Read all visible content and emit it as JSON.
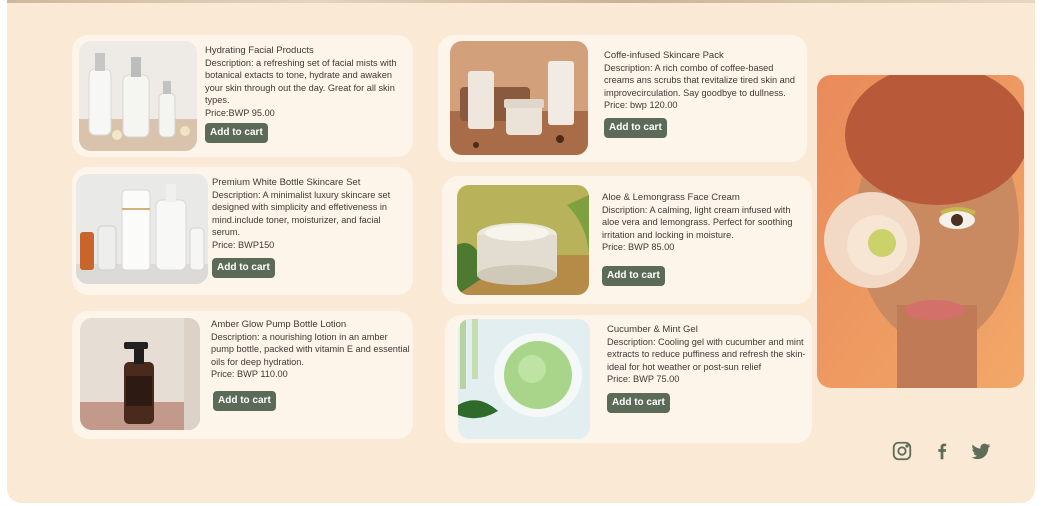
{
  "products": [
    {
      "title": "Hydrating Facial Products",
      "description": "Description: a refreshing set of facial mists with botanical extacts to tone, hydrate and awaken your skin through out the day. Great for all skin types.",
      "price": "Price:BWP 95.00",
      "button_label": "Add to cart",
      "image": "glass-serum-bottles"
    },
    {
      "title": "Coffe-infused Skincare Pack",
      "description": "Description: A rich combo of coffee-based creams ans scrubs that revitalize tired skin and improvecirculation. Say goodbye to dullness.",
      "price": "Price: bwp 120.00",
      "button_label": "Add to cart",
      "image": "coffee-skincare-tubes"
    },
    {
      "title": "Premium White Bottle Skincare Set",
      "description": "Description: A minimalist luxury skincare set designed with simplicity and effetiveness in mind.include toner, moisturizer, and facial serum.",
      "price": "Price: BWP150",
      "button_label": "Add to cart",
      "image": "white-bottles"
    },
    {
      "title": "Aloe & Lemongrass Face Cream",
      "description": "Discription: A calming, light cream infused with aloe vera and lemongrass. Perfect for soothing irritation and locking in moisture.",
      "price": "Price: BWP 85.00",
      "button_label": "Add to cart",
      "image": "face-cream-jar"
    },
    {
      "title": "Amber Glow Pump Bottle Lotion",
      "description": "Description: a nourishing lotion in an amber pump bottle, packed with vitamin E and essential oils for deep hydration.",
      "price": "Price: BWP 110.00",
      "button_label": "Add to cart",
      "image": "amber-pump-bottle"
    },
    {
      "title": "Cucumber & Mint Gel",
      "description": "Description: Cooling gel with cucumber and mint extracts to reduce puffiness and refresh the skin-ideal for hot weather or post-sun relief",
      "price": "Price: BWP 75.00",
      "button_label": "Add to cart",
      "image": "green-gel-bowl"
    }
  ],
  "hero_image": "model-with-flower",
  "social": [
    "instagram-icon",
    "facebook-icon",
    "twitter-icon"
  ],
  "colors": {
    "background": "#fae9d4",
    "card": "#fdf4ea",
    "button": "#5b6b58",
    "icon": "#5e6d5a"
  }
}
